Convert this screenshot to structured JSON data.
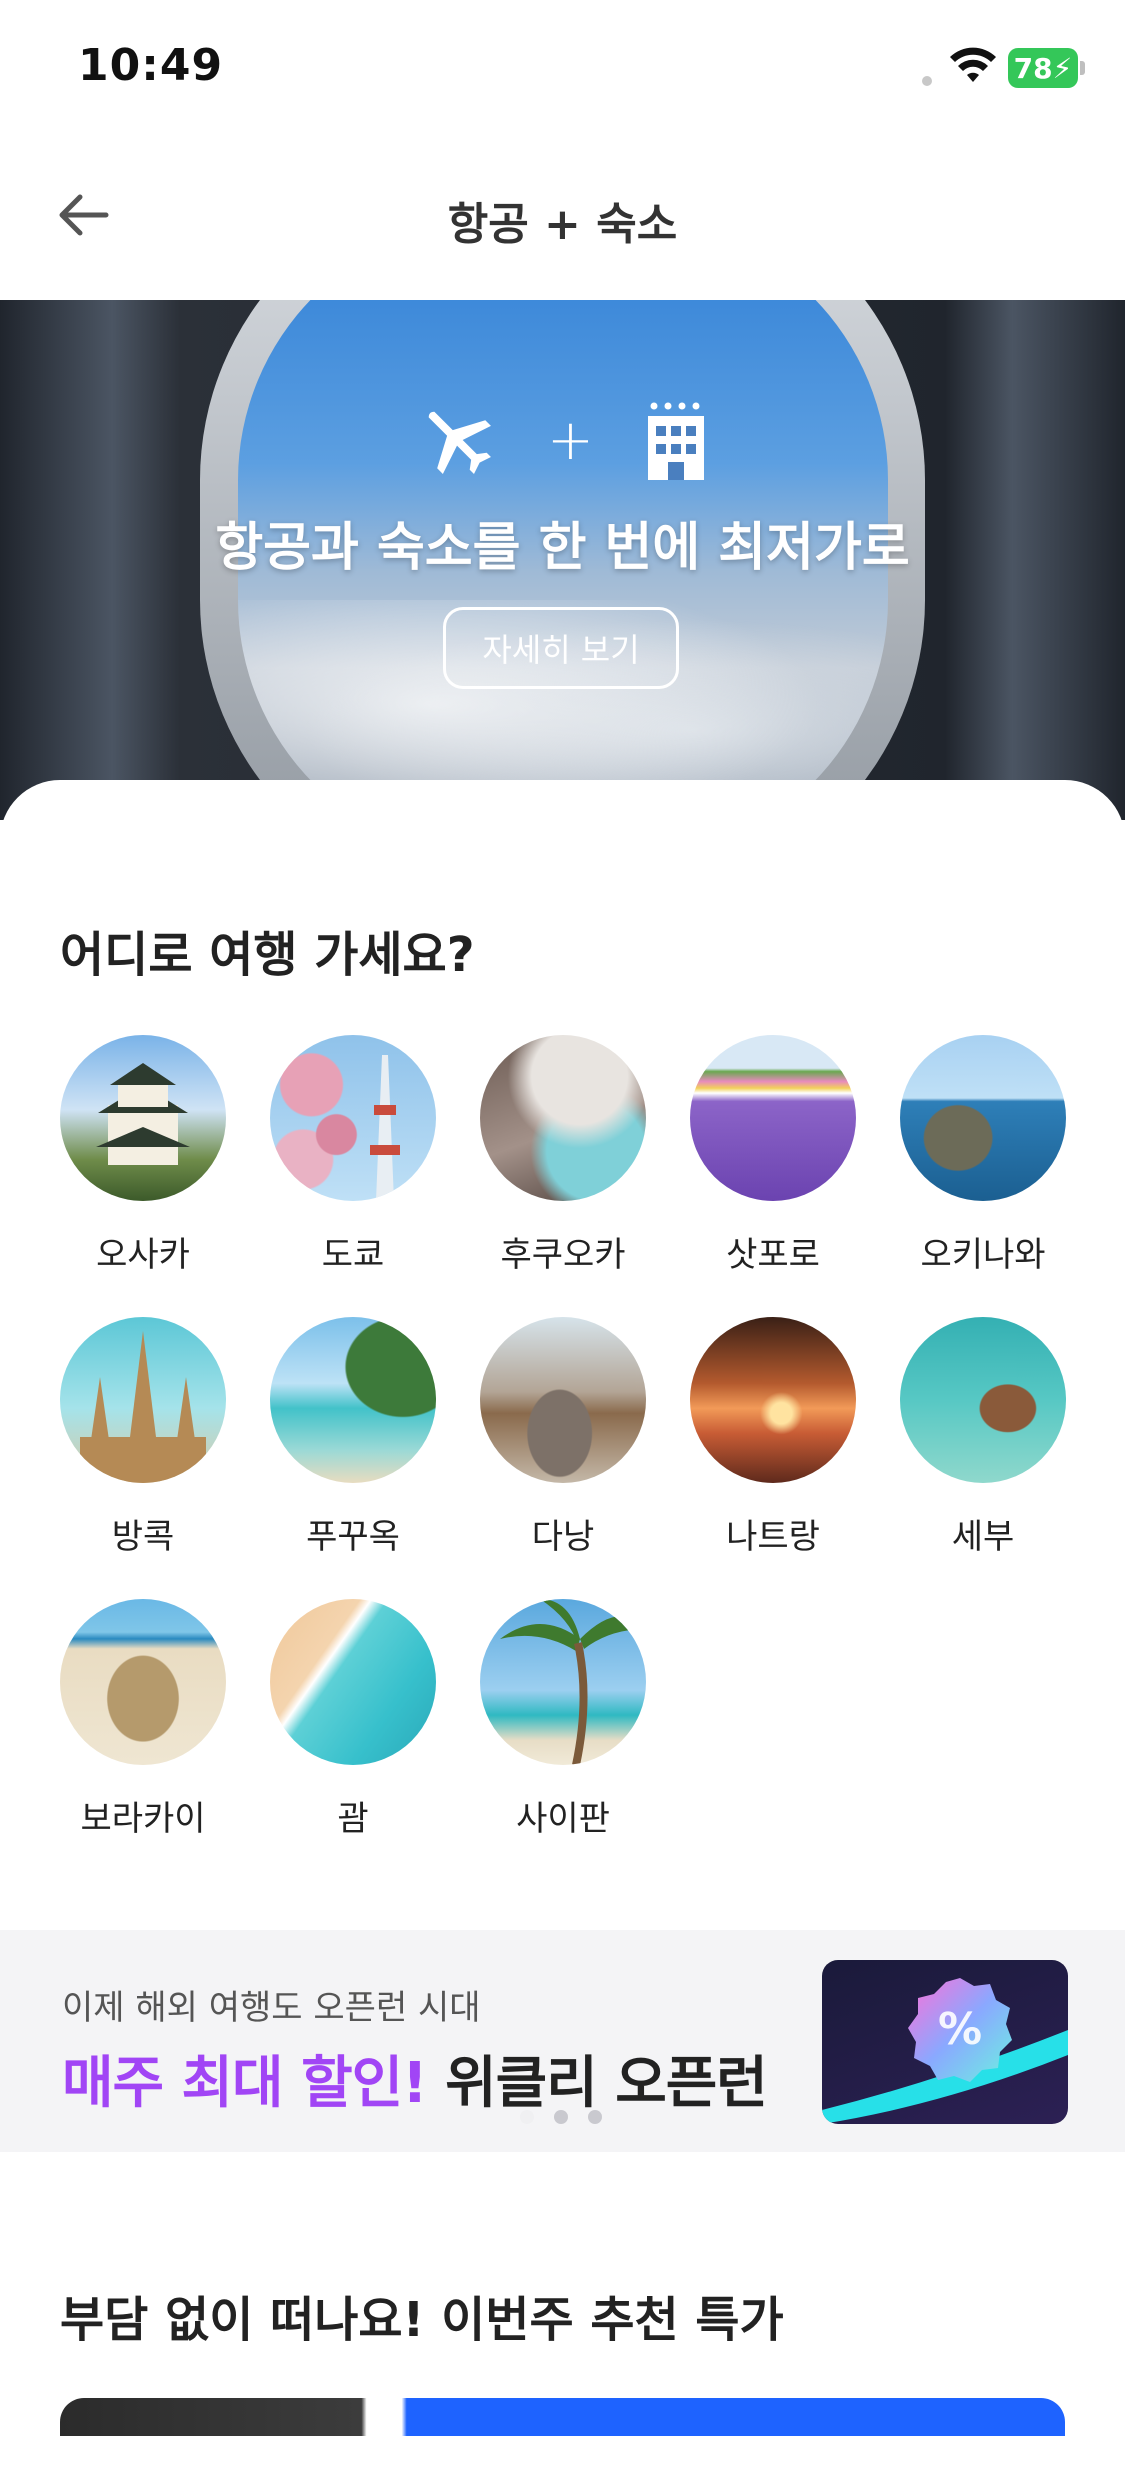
{
  "status_bar": {
    "time": "10:49",
    "battery": "78"
  },
  "header": {
    "title": "항공 + 숙소"
  },
  "hero": {
    "title": "항공과 숙소를 한 번에 최저가로",
    "button_label": "자세히 보기"
  },
  "destinations_section": {
    "title": "어디로 여행 가세요?",
    "items": [
      {
        "label": "오사카"
      },
      {
        "label": "도쿄"
      },
      {
        "label": "후쿠오카"
      },
      {
        "label": "삿포로"
      },
      {
        "label": "오키나와"
      },
      {
        "label": "방콕"
      },
      {
        "label": "푸꾸옥"
      },
      {
        "label": "다낭"
      },
      {
        "label": "나트랑"
      },
      {
        "label": "세부"
      },
      {
        "label": "보라카이"
      },
      {
        "label": "괌"
      },
      {
        "label": "사이판"
      }
    ]
  },
  "promo": {
    "subtitle": "이제 해외 여행도 오픈런 시대",
    "title_accent": "매주 최대 할인!",
    "title_rest": " 위클리 오픈런",
    "carousel": {
      "pages": 3,
      "active": 1
    }
  },
  "deals_section": {
    "title": "부담 없이 떠나요! 이번주 추천 특가"
  },
  "colors": {
    "accent": "#a145f5",
    "battery": "#34c759"
  }
}
